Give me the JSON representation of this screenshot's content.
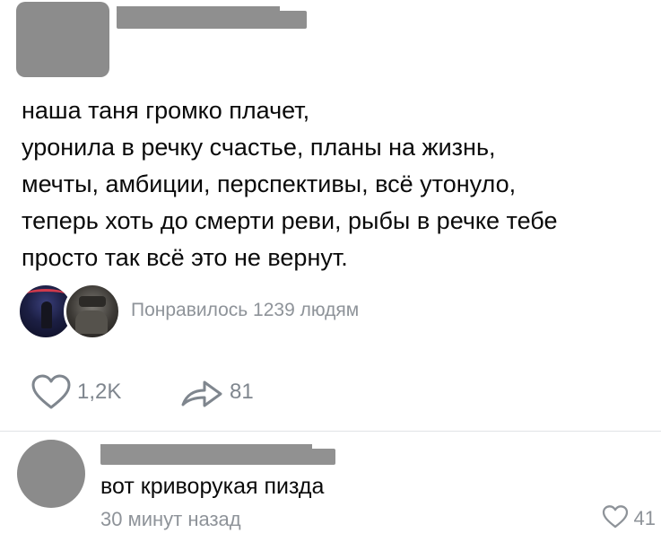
{
  "post": {
    "text_lines": [
      "наша таня громко плачет,",
      "уронила в речку счастье, планы на жизнь,",
      "мечты, амбиции, перспективы, всё утонуло,",
      "теперь хоть до смерти реви, рыбы в речке тебе",
      "просто так всё это не вернут."
    ],
    "likes_summary": "Понравилось 1239 людям",
    "actions": {
      "like_count": "1,2K",
      "share_count": "81"
    }
  },
  "comment": {
    "text": "вот криворукая пизда",
    "time": "30 минут назад",
    "like_count": "41"
  },
  "icons": {
    "like": "heart-outline-icon",
    "share": "share-arrow-icon"
  },
  "colors": {
    "redaction": "#8f8f8f",
    "secondary_text": "#8e9399",
    "action_icon": "#7f868e",
    "divider": "#e1e3e6"
  }
}
